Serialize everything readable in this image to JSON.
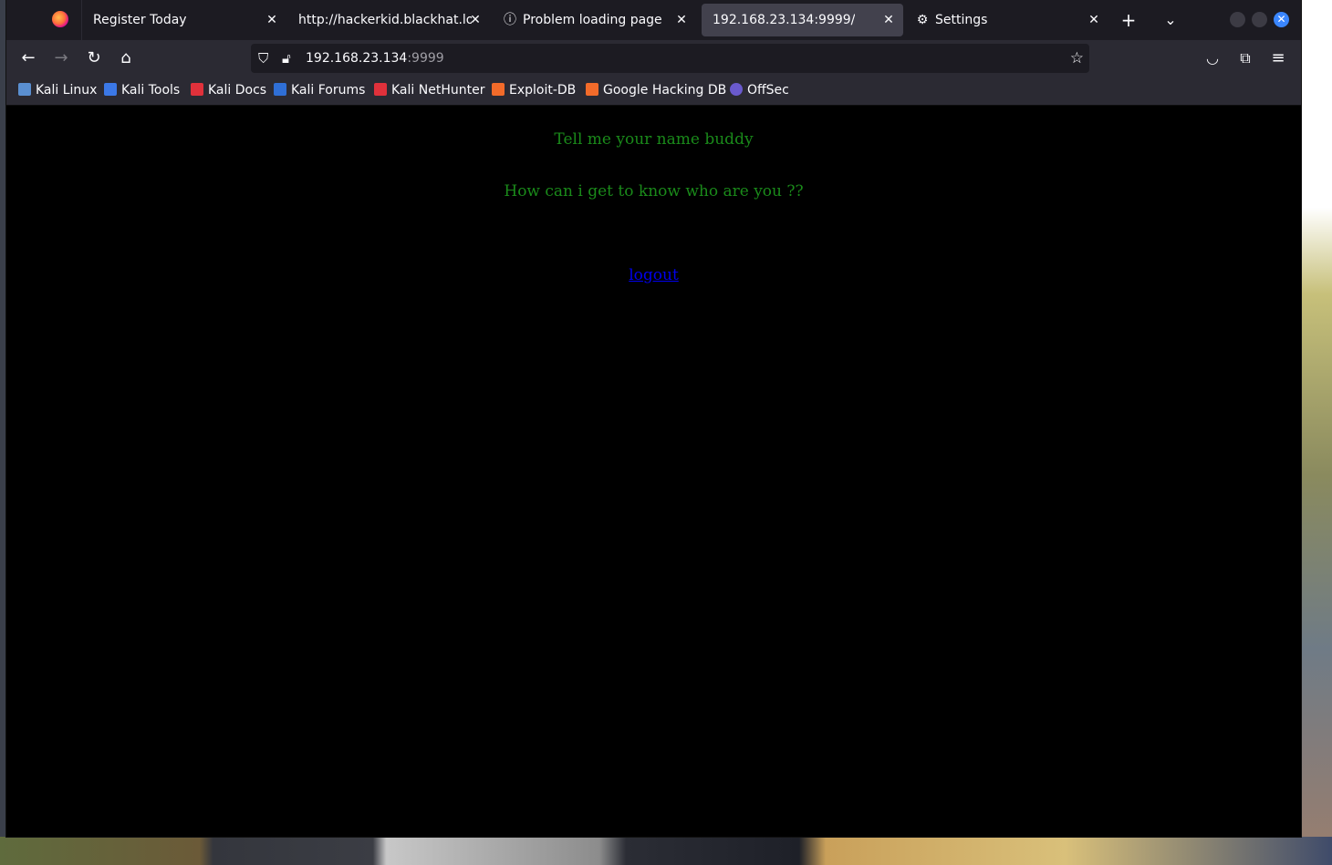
{
  "tabs": [
    {
      "title": "Register Today",
      "active": false
    },
    {
      "title": "http://hackerkid.blackhat.loc",
      "active": false
    },
    {
      "title": "Problem loading page",
      "active": false,
      "icon": "info-icon"
    },
    {
      "title": "192.168.23.134:9999/",
      "active": true
    },
    {
      "title": "Settings",
      "active": false,
      "icon": "gear-icon"
    }
  ],
  "toolbar": {
    "url_host": "192.168.23.134",
    "url_port": ":9999"
  },
  "bookmarks": [
    {
      "label": "Kali Linux",
      "color": "#5a8fd1"
    },
    {
      "label": "Kali Tools",
      "color": "#3b78e7"
    },
    {
      "label": "Kali Docs",
      "color": "#e0313b"
    },
    {
      "label": "Kali Forums",
      "color": "#2f6fd6"
    },
    {
      "label": "Kali NetHunter",
      "color": "#e0313b"
    },
    {
      "label": "Exploit-DB",
      "color": "#f26b2a"
    },
    {
      "label": "Google Hacking DB",
      "color": "#f26b2a"
    },
    {
      "label": "OffSec",
      "color": "#6a5acd"
    }
  ],
  "page": {
    "line1": "Tell me your name buddy",
    "line2": "How can i get to know who are you ??",
    "logout": "logout"
  },
  "colors": {
    "text_green": "#1a8a1a",
    "link_blue": "#0000ee"
  }
}
